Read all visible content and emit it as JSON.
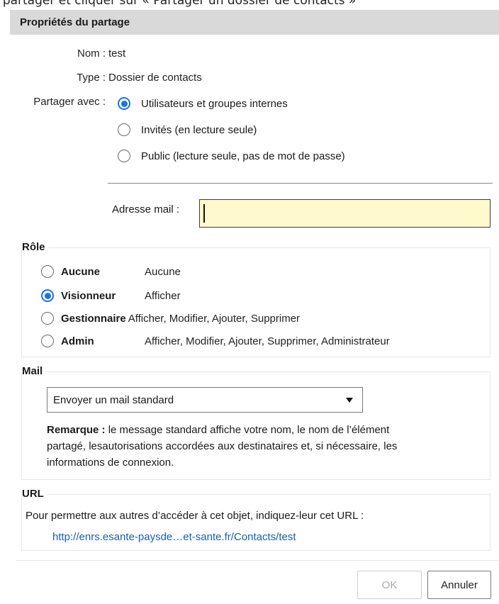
{
  "caption": "à partager et cliquer sur « Partager un dossier de contacts »",
  "dialog": {
    "title": "Propriétés du partage"
  },
  "info": {
    "name_label": "Nom :",
    "name_value": "test",
    "type_label": "Type :",
    "type_value": "Dossier de contacts",
    "share_with_label": "Partager avec :"
  },
  "share_options": [
    {
      "label": "Utilisateurs et groupes internes",
      "checked": true
    },
    {
      "label": "Invités (en lecture seule)",
      "checked": false
    },
    {
      "label": "Public (lecture seule, pas de mot de passe)",
      "checked": false
    }
  ],
  "email": {
    "label": "Adresse mail :",
    "value": "",
    "placeholder": ""
  },
  "role": {
    "legend": "Rôle",
    "options": [
      {
        "name": "Aucune",
        "description": "Aucune",
        "checked": false
      },
      {
        "name": "Visionneur",
        "description": "Afficher",
        "checked": true
      },
      {
        "name": "Gestionnaire",
        "description": "Afficher, Modifier, Ajouter, Supprimer",
        "checked": false
      },
      {
        "name": "Admin",
        "description": "Afficher, Modifier, Ajouter, Supprimer, Administrateur",
        "checked": false
      }
    ]
  },
  "mail": {
    "legend": "Mail",
    "selected": "Envoyer un mail standard",
    "note_bold": "Remarque :",
    "note_text": " le message standard affiche votre nom, le nom de l’élément partagé, lesautorisations accordées aux destinataires et, si nécessaire, les informations de connexion."
  },
  "url": {
    "legend": "URL",
    "text": "Pour permettre aux autres d’accéder à cet objet, indiquez-leur cet URL :",
    "link": "http://enrs.esante-paysde…et-sante.fr/Contacts/test"
  },
  "buttons": {
    "ok": "OK",
    "cancel": "Annuler"
  },
  "colors": {
    "accent": "#1a73e8",
    "input_bg": "#fffacd",
    "titlebar_bg": "#d9d9d9",
    "link": "#1a5fb4"
  }
}
